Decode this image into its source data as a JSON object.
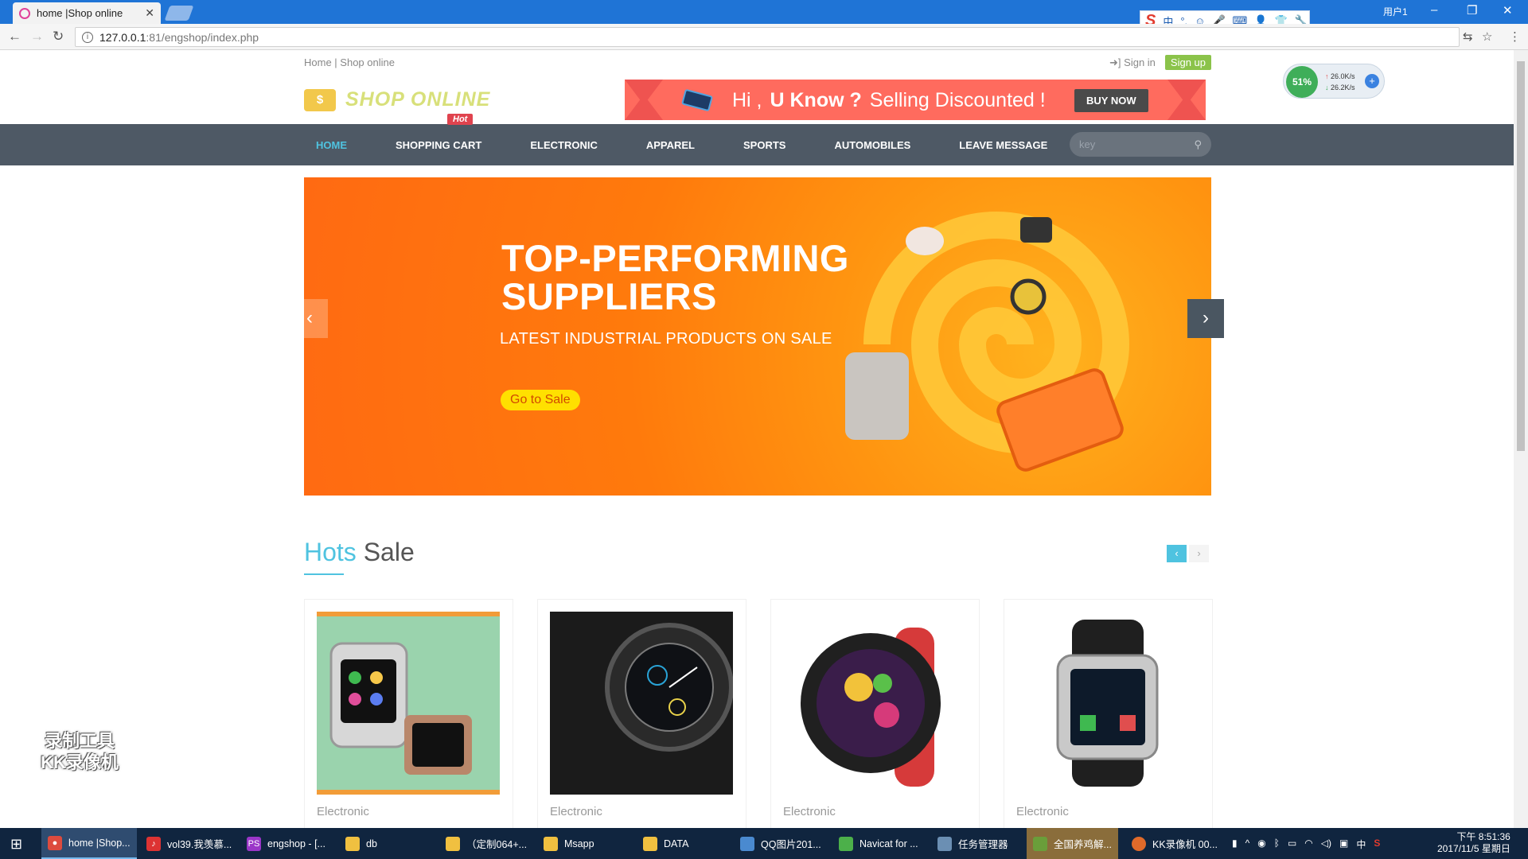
{
  "browser": {
    "tab_title": "home |Shop online",
    "tab_close": "✕",
    "url_host": "127.0.0.1",
    "url_path": ":81/engshop/index.php",
    "user_label": "用户1"
  },
  "ime": {
    "items": [
      "中",
      "°,",
      "☺",
      "🎤",
      "⌨",
      "👤",
      "👕",
      "🔧"
    ]
  },
  "header": {
    "breadcrumb_home": "Home",
    "breadcrumb_sep": " | ",
    "breadcrumb_site": "Shop online",
    "signin": "Sign in",
    "signup": "Sign up",
    "logo_icon": "$",
    "logo_text": "SHOP ONLINE"
  },
  "promo": {
    "hi": "Hi ,",
    "know": "U Know ?",
    "text": "Selling Discounted !",
    "button": "BUY NOW"
  },
  "nav": {
    "items": [
      "HOME",
      "SHOPPING CART",
      "ELECTRONIC",
      "APPAREL",
      "SPORTS",
      "AUTOMOBILES",
      "LEAVE MESSAGE"
    ],
    "hot_badge": "Hot",
    "search_placeholder": "key"
  },
  "slider": {
    "title": "TOP-PERFORMING SUPPLIERS",
    "subtitle": "LATEST INDUSTRIAL PRODUCTS ON SALE",
    "button": "Go to Sale",
    "prev": "‹",
    "next": "›"
  },
  "hot_sale": {
    "title_first": "Hots",
    "title_rest": " Sale",
    "prev": "‹",
    "next": "›",
    "products": [
      {
        "category": "Electronic"
      },
      {
        "category": "Electronic"
      },
      {
        "category": "Electronic"
      },
      {
        "category": "Electronic"
      }
    ]
  },
  "watermark": {
    "line1": "录制工具",
    "line2": "KK录像机"
  },
  "netmon": {
    "percent": "51%",
    "up": "26.0K/s",
    "down": "26.2K/s"
  },
  "taskbar": {
    "items": [
      {
        "label": "home |Shop..."
      },
      {
        "label": "vol39.我羡慕..."
      },
      {
        "label": "engshop - [..."
      },
      {
        "label": "db"
      },
      {
        "label": "（定制064+..."
      },
      {
        "label": "Msapp"
      },
      {
        "label": "DATA"
      },
      {
        "label": "QQ图片201..."
      },
      {
        "label": "Navicat for ..."
      },
      {
        "label": "任务管理器"
      },
      {
        "label": "全国养鸡解..."
      },
      {
        "label": "KK录像机 00..."
      }
    ],
    "ime_indicator": "中",
    "time": "下午 8:51:36",
    "date": "2017/11/5 星期日"
  },
  "colors": {
    "accent": "#4fc3e0",
    "nav_bg": "#4e5965",
    "promo": "#ff6b5e",
    "signup": "#8bc34a",
    "slider": "#ff8a0f"
  }
}
